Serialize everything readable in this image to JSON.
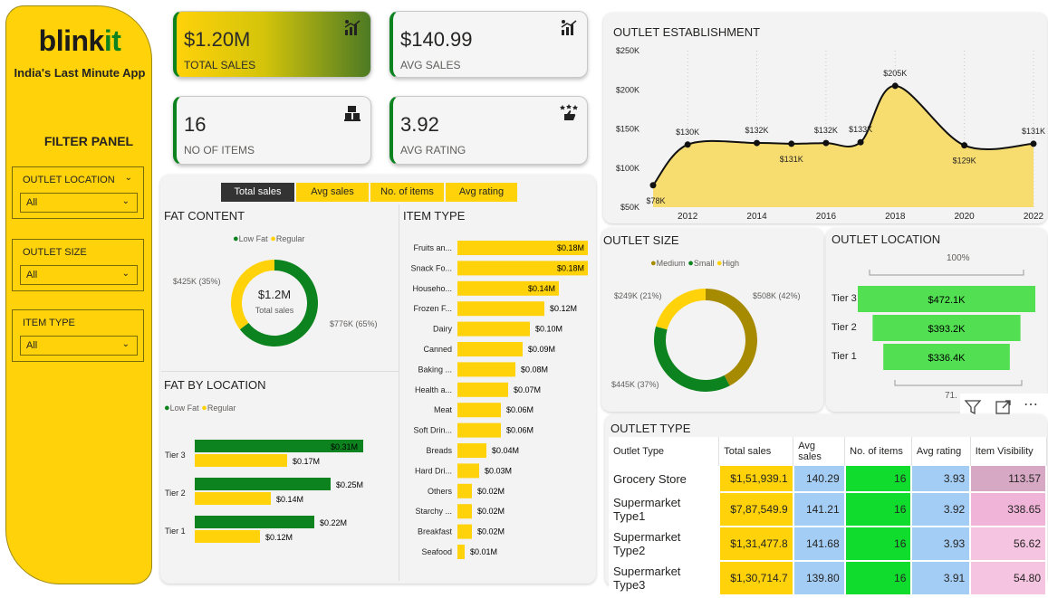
{
  "brand": {
    "name_a": "blink",
    "name_b": "it",
    "tagline": "India's Last Minute App"
  },
  "filter_panel": {
    "title": "FILTER PANEL",
    "slicers": [
      {
        "label": "OUTLET LOCATION",
        "value": "All"
      },
      {
        "label": "OUTLET SIZE",
        "value": "All"
      },
      {
        "label": "ITEM TYPE",
        "value": "All"
      }
    ]
  },
  "kpis": {
    "total_sales": {
      "value": "$1.20M",
      "caption": "TOTAL SALES"
    },
    "avg_sales": {
      "value": "$140.99",
      "caption": "AVG SALES"
    },
    "items": {
      "value": "16",
      "caption": "NO OF ITEMS"
    },
    "avg_rating": {
      "value": "3.92",
      "caption": "AVG RATING"
    }
  },
  "colors": {
    "yellow": "#ffd20a",
    "green": "#0c831f",
    "olive": "#a68a00",
    "area_fill": "#f7dc6f",
    "bright_green": "#52e052"
  },
  "tabs": [
    "Total sales",
    "Avg sales",
    "No. of items",
    "Avg rating"
  ],
  "fat_content": {
    "title": "FAT CONTENT",
    "legend": [
      "Low Fat",
      "Regular"
    ],
    "center_value": "$1.2M",
    "center_label": "Total sales",
    "label_regular": "$425K (35%)",
    "label_lowfat": "$776K (65%)",
    "chart_data": {
      "type": "pie",
      "categories": [
        "Low Fat",
        "Regular"
      ],
      "values": [
        776,
        425
      ]
    }
  },
  "item_type": {
    "title": "ITEM TYPE",
    "chart_data": {
      "type": "bar",
      "categories": [
        "Fruits an...",
        "Snack Fo...",
        "Househo...",
        "Frozen F...",
        "Dairy",
        "Canned",
        "Baking ...",
        "Health a...",
        "Meat",
        "Soft Drin...",
        "Breads",
        "Hard Dri...",
        "Others",
        "Starchy ...",
        "Breakfast",
        "Seafood"
      ],
      "values": [
        0.18,
        0.18,
        0.14,
        0.12,
        0.1,
        0.09,
        0.08,
        0.07,
        0.06,
        0.06,
        0.04,
        0.03,
        0.02,
        0.02,
        0.02,
        0.01
      ],
      "labels": [
        "$0.18M",
        "$0.18M",
        "$0.14M",
        "$0.12M",
        "$0.10M",
        "$0.09M",
        "$0.08M",
        "$0.07M",
        "$0.06M",
        "$0.06M",
        "$0.04M",
        "$0.03M",
        "$0.02M",
        "$0.02M",
        "$0.02M",
        "$0.01M"
      ]
    }
  },
  "fat_by_location": {
    "title": "FAT BY LOCATION",
    "legend": [
      "Low Fat",
      "Regular"
    ],
    "chart_data": {
      "type": "bar",
      "categories": [
        "Tier 3",
        "Tier 2",
        "Tier 1"
      ],
      "series": [
        {
          "name": "Low Fat",
          "values": [
            0.31,
            0.25,
            0.22
          ],
          "labels": [
            "$0.31M",
            "$0.25M",
            "$0.22M"
          ]
        },
        {
          "name": "Regular",
          "values": [
            0.17,
            0.14,
            0.12
          ],
          "labels": [
            "$0.17M",
            "$0.14M",
            "$0.12M"
          ]
        }
      ]
    }
  },
  "outlet_establishment": {
    "title": "OUTLET ESTABLISHMENT",
    "chart_data": {
      "type": "area",
      "x": [
        2011,
        2012,
        2014,
        2015,
        2016,
        2017,
        2018,
        2020,
        2022
      ],
      "values": [
        78,
        130,
        132,
        131,
        132,
        133,
        205,
        129,
        131
      ],
      "labels": [
        "$78K",
        "$130K",
        "$132K",
        "$131K",
        "$132K",
        "$133K",
        "$205K",
        "$129K",
        "$131K"
      ],
      "label_pos": [
        "below",
        "above",
        "above",
        "below",
        "above",
        "above",
        "above",
        "below",
        "above"
      ],
      "yticks": [
        "$50K",
        "$100K",
        "$150K",
        "$200K",
        "$250K"
      ],
      "ytick_values": [
        50,
        100,
        150,
        200,
        250
      ],
      "xticks": [
        "2012",
        "2014",
        "2016",
        "2018",
        "2020",
        "2022"
      ],
      "xtick_values": [
        2012,
        2014,
        2016,
        2018,
        2020,
        2022
      ],
      "ylim": [
        50,
        250
      ],
      "xlim": [
        2011,
        2022
      ]
    }
  },
  "outlet_size": {
    "title": "OUTLET SIZE",
    "legend": [
      "Medium",
      "Small",
      "High"
    ],
    "labels": {
      "high": "$249K (21%)",
      "medium": "$508K (42%)",
      "small": "$445K (37%)"
    },
    "chart_data": {
      "type": "pie",
      "categories": [
        "Medium",
        "Small",
        "High"
      ],
      "values": [
        508,
        445,
        249
      ]
    }
  },
  "outlet_location": {
    "title": "OUTLET LOCATION",
    "top_label": "100%",
    "bottom_label": "71.",
    "chart_data": {
      "type": "bar",
      "categories": [
        "Tier 3",
        "Tier 2",
        "Tier 1"
      ],
      "values": [
        472.1,
        393.2,
        336.4
      ],
      "labels": [
        "$472.1K",
        "$393.2K",
        "$336.4K"
      ]
    }
  },
  "outlet_type": {
    "title": "OUTLET TYPE",
    "columns": [
      "Outlet Type",
      "Total sales",
      "Avg sales",
      "No. of items",
      "Avg rating",
      "Item Visibility"
    ],
    "rows": [
      [
        "Grocery Store",
        "$1,51,939.1",
        "140.29",
        "16",
        "3.93",
        "113.57"
      ],
      [
        "Supermarket Type1",
        "$7,87,549.9",
        "141.21",
        "16",
        "3.92",
        "338.65"
      ],
      [
        "Supermarket Type2",
        "$1,31,477.8",
        "141.68",
        "16",
        "3.93",
        "56.62"
      ],
      [
        "Supermarket Type3",
        "$1,30,714.7",
        "139.80",
        "16",
        "3.91",
        "54.80"
      ]
    ]
  }
}
